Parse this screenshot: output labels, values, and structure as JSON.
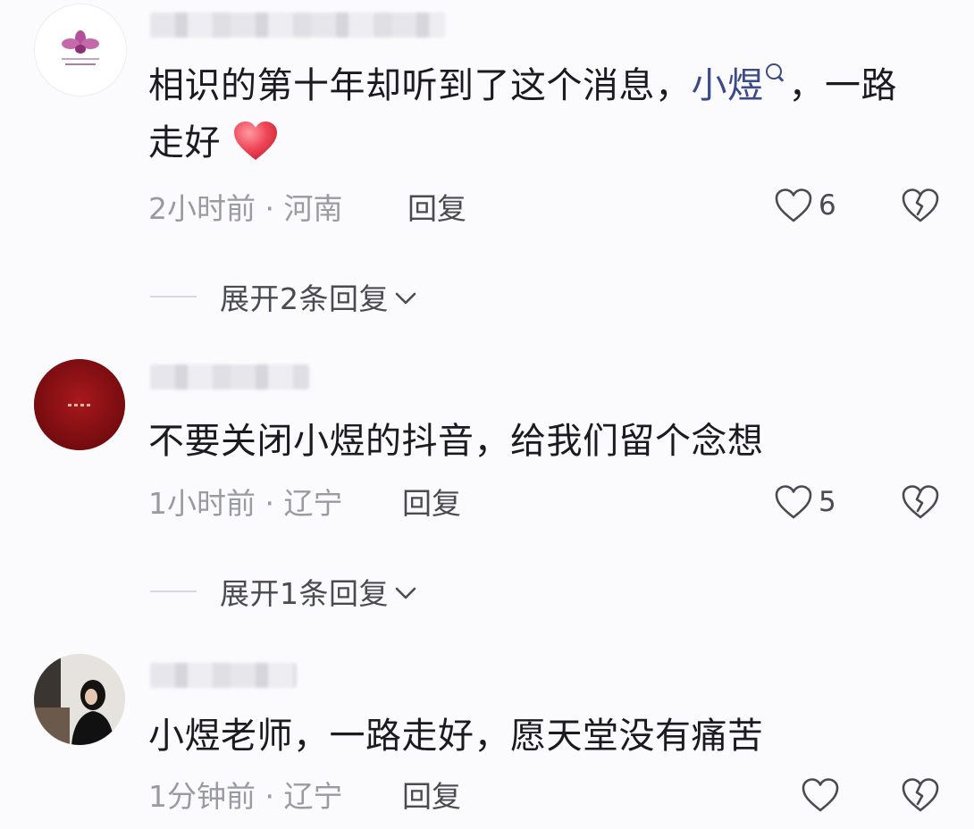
{
  "comments": [
    {
      "text_before": "相识的第十年却听到了这个消息，",
      "mention": "小煜",
      "text_after": "，一路",
      "text_line2": "走好",
      "emoji": "red-heart",
      "time": "2小时前",
      "location": "河南",
      "reply_label": "回复",
      "likes": "6",
      "expand_label": "展开2条回复"
    },
    {
      "text": "不要关闭小煜的抖音，给我们留个念想",
      "time": "1小时前",
      "location": "辽宁",
      "reply_label": "回复",
      "likes": "5",
      "expand_label": "展开1条回复"
    },
    {
      "text": "小煜老师，一路走好，愿天堂没有痛苦",
      "time": "1分钟前",
      "location": "辽宁",
      "reply_label": "回复",
      "likes": ""
    }
  ],
  "meta_separator": " · ",
  "colors": {
    "background": "#fbfbfd",
    "text": "#1b1b1f",
    "meta": "#9a9aa3",
    "mention": "#3b4a8a",
    "heart_emoji": "#f04a5a"
  },
  "icons": [
    "heart-outline-icon",
    "broken-heart-icon",
    "chevron-down-icon",
    "search-icon"
  ]
}
